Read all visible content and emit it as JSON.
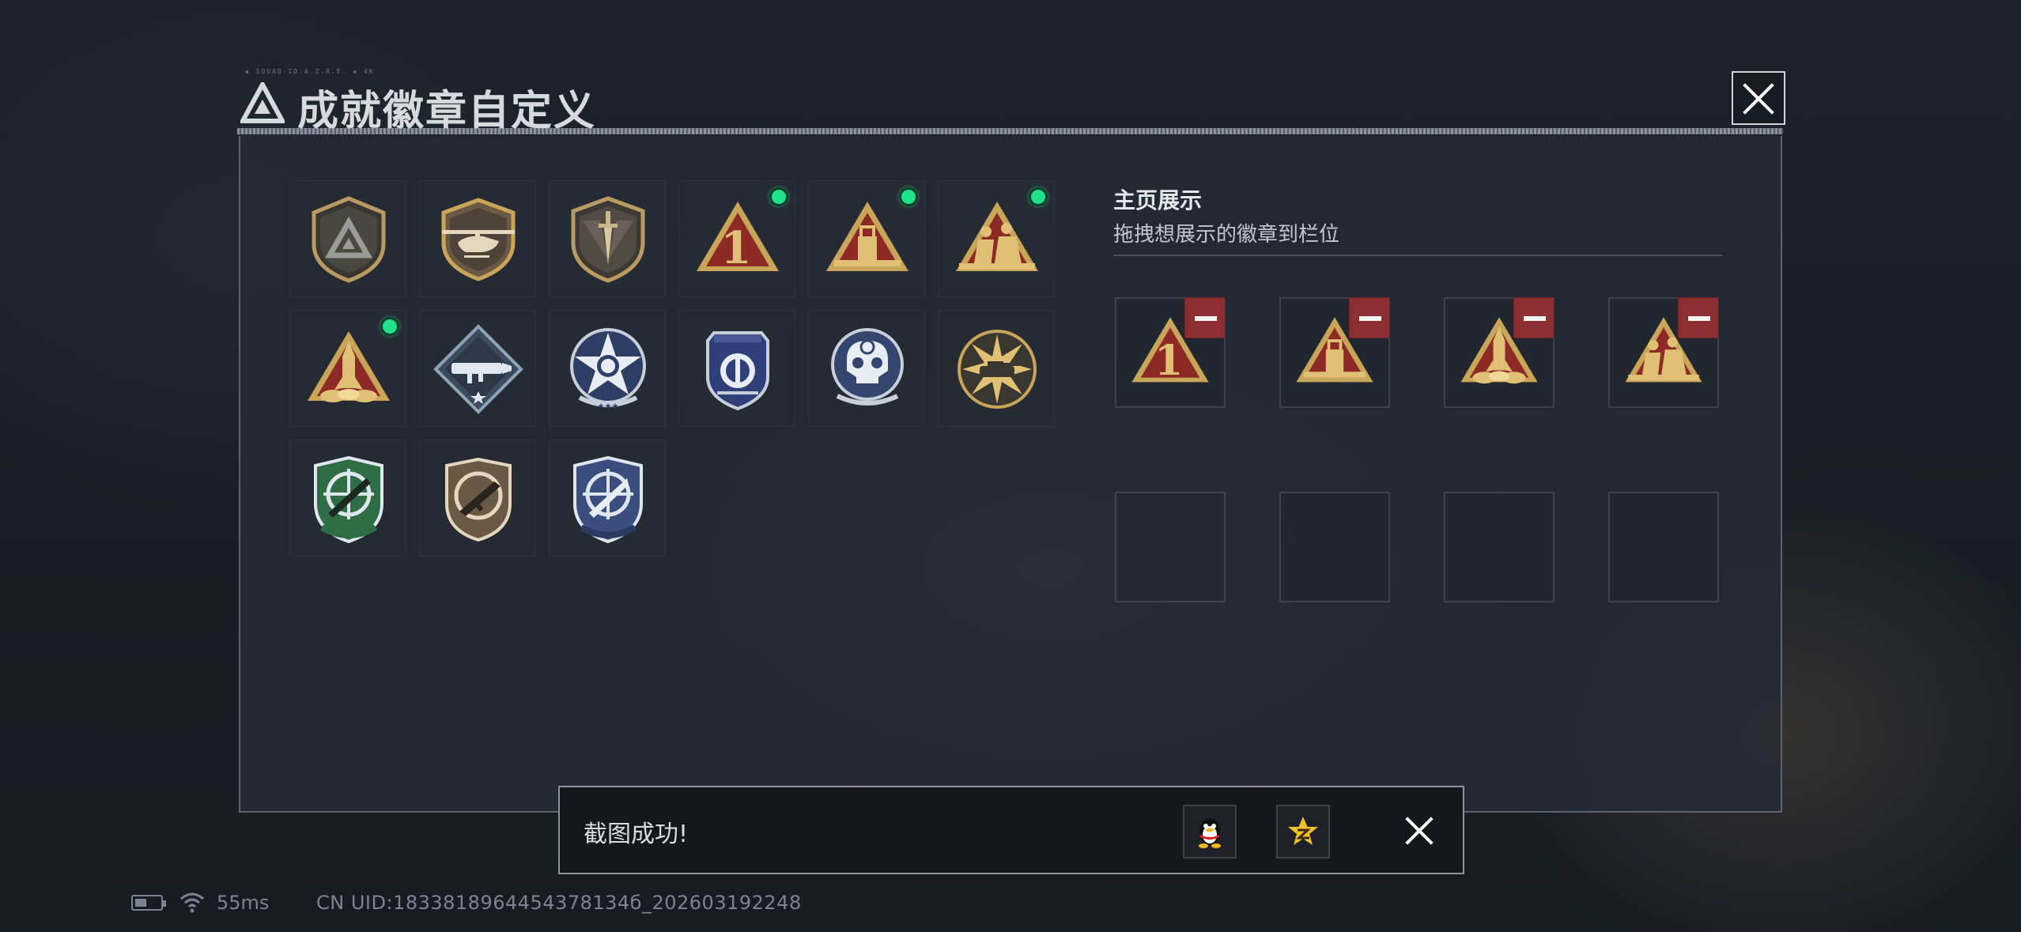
{
  "window": {
    "title": "成就徽章自定义",
    "title_deco": "▪ SQUAD-ID.A.Z.R.E. ▪ 4K",
    "close_icon": "close-x-icon"
  },
  "inventory": {
    "badges": [
      {
        "icon": "triangle-emblem-shield-icon",
        "equipped": false
      },
      {
        "icon": "helicopter-shield-icon",
        "equipped": false
      },
      {
        "icon": "dagger-shield-icon",
        "equipped": false
      },
      {
        "icon": "rank-one-triangle-icon",
        "equipped": true
      },
      {
        "icon": "usb-drive-triangle-icon",
        "equipped": true
      },
      {
        "icon": "soldiers-triangle-icon",
        "equipped": true
      },
      {
        "icon": "rocket-triangle-icon",
        "equipped": true
      },
      {
        "icon": "rocket-launcher-diamond-icon",
        "equipped": false
      },
      {
        "icon": "star-skull-medal-icon",
        "equipped": false
      },
      {
        "icon": "blue-shield-crest-icon",
        "equipped": false
      },
      {
        "icon": "skull-crosshair-medal-icon",
        "equipped": false
      },
      {
        "icon": "tank-burst-medal-icon",
        "equipped": false
      },
      {
        "icon": "green-rifle-crosshair-shield-icon",
        "equipped": false
      },
      {
        "icon": "bronze-smg-shield-icon",
        "equipped": false
      },
      {
        "icon": "blue-knife-crosshair-shield-icon",
        "equipped": false
      }
    ]
  },
  "display": {
    "heading": "主页展示",
    "instruction": "拖拽想展示的徽章到栏位",
    "slots": [
      {
        "icon": "rank-one-triangle-icon",
        "filled": true
      },
      {
        "icon": "usb-drive-triangle-icon",
        "filled": true
      },
      {
        "icon": "rocket-triangle-icon",
        "filled": true
      },
      {
        "icon": "soldiers-triangle-icon",
        "filled": true
      },
      {
        "icon": "",
        "filled": false
      },
      {
        "icon": "",
        "filled": false
      },
      {
        "icon": "",
        "filled": false
      },
      {
        "icon": "",
        "filled": false
      }
    ]
  },
  "toast": {
    "message": "截图成功!",
    "share_buttons": [
      "qq-penguin-icon",
      "qzone-star-icon"
    ]
  },
  "status_bar": {
    "ping": "55ms",
    "uid": "CN UID:1833818964454378134б_202603192248"
  },
  "colors": {
    "panel_bg": "#262c36",
    "equipped_dot": "#1fe28a",
    "remove_button": "#8b2f33",
    "badge_red": "#8e2a25",
    "badge_gold": "#c9a55a"
  }
}
